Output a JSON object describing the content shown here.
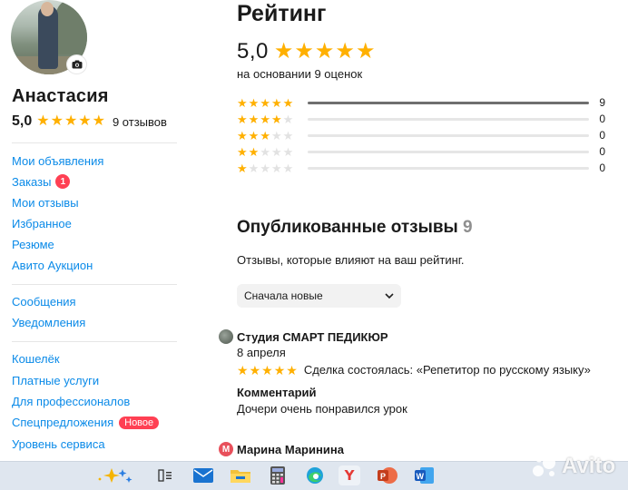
{
  "profile": {
    "name": "Анастасия",
    "rating": "5,0",
    "reviews_count": "9 отзывов",
    "stars": 5
  },
  "nav": {
    "group1": [
      {
        "label": "Мои объявления"
      },
      {
        "label": "Заказы",
        "badge": "1"
      },
      {
        "label": "Мои отзывы"
      },
      {
        "label": "Избранное"
      },
      {
        "label": "Резюме"
      },
      {
        "label": "Авито Аукцион"
      }
    ],
    "group2": [
      {
        "label": "Сообщения"
      },
      {
        "label": "Уведомления"
      }
    ],
    "group3": [
      {
        "label": "Кошелёк"
      },
      {
        "label": "Платные услуги"
      },
      {
        "label": "Для профессионалов"
      },
      {
        "label": "Спецпредложения",
        "tag": "Новое"
      },
      {
        "label": "Уровень сервиса"
      }
    ]
  },
  "rating": {
    "title": "Рейтинг",
    "value": "5,0",
    "basis": "на основании 9 оценок",
    "distribution": [
      {
        "stars": 5,
        "count": "9",
        "fraction": 1.0
      },
      {
        "stars": 4,
        "count": "0",
        "fraction": 0
      },
      {
        "stars": 3,
        "count": "0",
        "fraction": 0
      },
      {
        "stars": 2,
        "count": "0",
        "fraction": 0
      },
      {
        "stars": 1,
        "count": "0",
        "fraction": 0
      }
    ]
  },
  "reviews": {
    "title": "Опубликованные отзывы",
    "count": "9",
    "note": "Отзывы, которые влияют на ваш рейтинг.",
    "sort_value": "Сначала новые",
    "items": [
      {
        "author": "Студия СМАРТ ПЕДИКЮР",
        "date": "8 апреля",
        "stars": 5,
        "deal": "Сделка состоялась: «Репетитор по русскому языку»",
        "comment_label": "Комментарий",
        "comment": "Дочери очень понравился урок"
      },
      {
        "author": "Марина Маринина",
        "avatar_letter": "М"
      }
    ]
  },
  "taskbar": {
    "icons": [
      "copilot-icon",
      "task-view-icon",
      "mail-icon",
      "file-explorer-icon",
      "calculator-icon",
      "edge-icon",
      "yandex-browser-icon",
      "powerpoint-icon",
      "word-icon"
    ]
  },
  "watermark": {
    "text": "Avito"
  },
  "colors": {
    "link": "#0a8ae8",
    "star": "#ffb000",
    "badge": "#ff4053"
  }
}
